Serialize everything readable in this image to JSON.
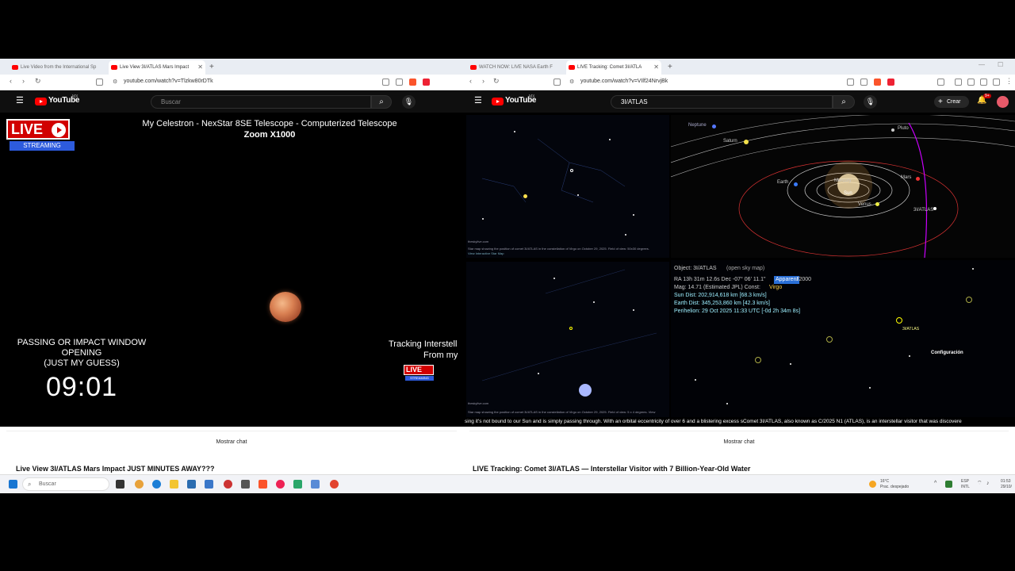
{
  "left": {
    "tabs": [
      {
        "label": "Live Video from the International Sp"
      },
      {
        "label": "Live View 3I/ATLAS Mars Impact"
      }
    ],
    "url": "youtube.com/watch?v=Tlzkw80rDTk",
    "search_placeholder": "Buscar",
    "logo": "YouTube",
    "logo_region": "MX",
    "player": {
      "live_label": "LIVE",
      "streaming_label": "STREAMING",
      "title_line1": "My Celestron - NexStar 8SE Telescope - Computerized Telescope",
      "title_line2": "Zoom X1000",
      "window_line1": "PASSING OR IMPACT WINDOW",
      "window_line2": "OPENING",
      "window_line3": "(JUST MY GUESS)",
      "countdown": "09:01",
      "tracking_line1": "Tracking Interstell",
      "tracking_line2": "From my"
    },
    "show_chat": "Mostrar chat",
    "video_title": "Live View 3I/ATLAS Mars Impact JUST MINUTES AWAY???"
  },
  "right": {
    "tabs": [
      {
        "label": "WATCH NOW: LIVE NASA Earth F"
      },
      {
        "label": "LIVE Tracking: Comet 3I/ATLA"
      }
    ],
    "url": "youtube.com/watch?v=VIlf24NrvjBk",
    "search_value": "3I/ATLAS",
    "logo": "YouTube",
    "logo_region": "MX",
    "create_label": "Crear",
    "notif_count": "9+",
    "skymap": {
      "site_top": "theskylive.com",
      "caption_top": "Star map showing the position of comet 3I/ATLAS in the constellation of Virgo on October 29, 2025. Field of view: 50x30 degrees.",
      "caption_top2": "View Interactive Star Map",
      "site_bottom": "theskylive.com",
      "caption_bottom": "Star map showing the position of comet 3I/ATLAS in the constellation of Virgo on October 29, 2025. Field of view: 5 x 4 degrees. View"
    },
    "orbit": {
      "planets": [
        "Neptune",
        "Saturn",
        "Pluto",
        "Earth",
        "Mercury",
        "Mars",
        "Venus",
        "Sun",
        "3I/ATLAS"
      ]
    },
    "info": {
      "object": "Object: 3I/ATLAS",
      "open_sky": "(open sky map)",
      "ra_line": "RA 13h 31m 12.6s Dec -07° 06' 11.1\"",
      "epoch": "J2000",
      "mag_line": "Mag: 14.71 (Estimated JPL)  Const:",
      "const": "Virgo",
      "sun_dist": "Sun Dist: 202,914,618 km [68.3 km/s]",
      "earth_dist": "Earth Dist: 345,253,860 km [42.3 km/s]",
      "perihelion": "Perihelion: 29 Oct 2025 11:33 UTC [-0d 2h 34m 8s]",
      "comet_label": "3I/ATLAS",
      "config": "Configuración"
    },
    "ticker": "sing it's not bound to our Sun and is simply passing through. With an orbital eccentricity of over 6 and a blistering excess sComet 3I/ATLAS, also known as C/2025 N1 (ATLAS), is an interstellar visitor that was discovere",
    "show_chat": "Mostrar chat",
    "video_title": "LIVE Tracking: Comet 3I/ATLAS — Interstellar Visitor with 7 Billion-Year-Old Water"
  },
  "taskbar": {
    "search_placeholder": "Buscar",
    "weather_temp": "16°C",
    "weather_desc": "Prac. despejado",
    "lang": "ESP",
    "lang2": "INTL",
    "time": "01:53",
    "date": "29/10/"
  },
  "colors": {
    "youtube_red": "#ff0000",
    "live_red": "#d10000",
    "stream_blue": "#2d5bdd",
    "info_cyan": "#9ef0ff"
  }
}
